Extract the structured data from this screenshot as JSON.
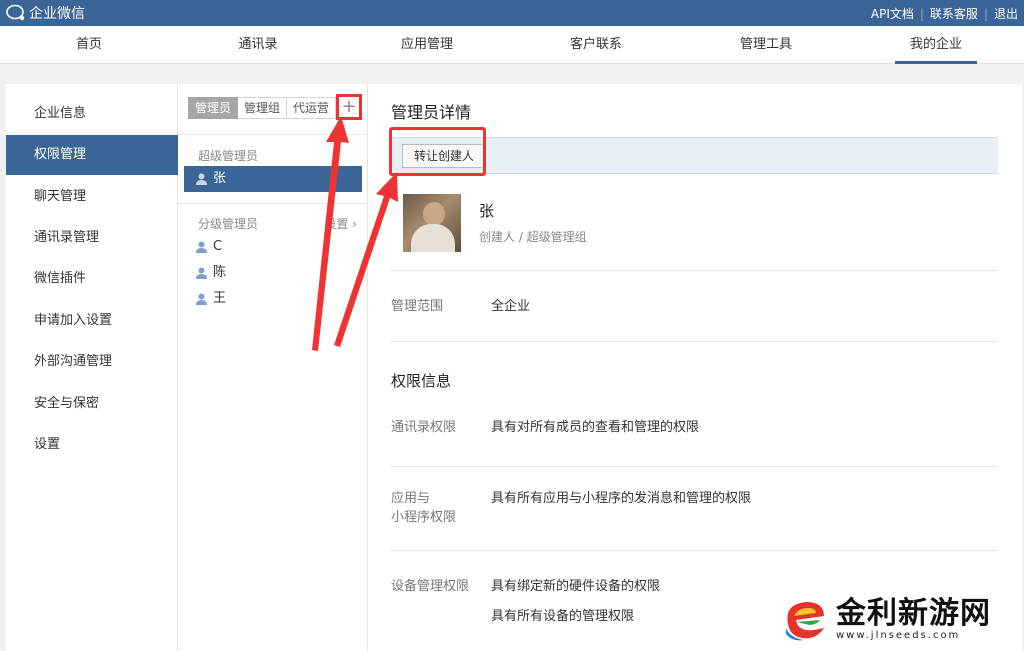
{
  "topbar": {
    "app_title": "企业微信",
    "links": [
      "API文档",
      "联系客服",
      "退出"
    ],
    "separator": "|"
  },
  "nav": {
    "items": [
      "首页",
      "通讯录",
      "应用管理",
      "客户联系",
      "管理工具",
      "我的企业"
    ],
    "active": "我的企业"
  },
  "sidebar": {
    "items": [
      "企业信息",
      "权限管理",
      "聊天管理",
      "通讯录管理",
      "微信插件",
      "申请加入设置",
      "外部沟通管理",
      "安全与保密",
      "设置"
    ],
    "active": "权限管理"
  },
  "admin_list": {
    "tabs": [
      "管理员",
      "管理组",
      "代运营"
    ],
    "active_tab": "管理员",
    "add_label": "+",
    "super_admin_title": "超级管理员",
    "super_admins": [
      "张"
    ],
    "sub_admin_title": "分级管理员",
    "sub_admin_settings": "设置",
    "sub_admin_settings_chevron": "›",
    "sub_admins": [
      "C",
      "陈",
      "王"
    ]
  },
  "detail": {
    "title": "管理员详情",
    "transfer_button": "转让创建人",
    "name": "张",
    "role": "创建人 / 超级管理组",
    "scope_label": "管理范围",
    "scope_value": "全企业",
    "permissions_title": "权限信息",
    "contacts_label": "通讯录权限",
    "contacts_value": "具有对所有成员的查看和管理的权限",
    "apps_label_line1": "应用与",
    "apps_label_line2": "小程序权限",
    "apps_value": "具有所有应用与小程序的发消息和管理的权限",
    "device_label": "设备管理权限",
    "device_value_1": "具有绑定新的硬件设备的权限",
    "device_value_2": "具有所有设备的管理权限"
  },
  "watermark": {
    "brand": "金利新游网",
    "url": "www.jlnseeds.com"
  },
  "colors": {
    "brand_blue": "#3b6596",
    "highlight_red": "#e33333",
    "action_bar": "#e8eef5"
  }
}
